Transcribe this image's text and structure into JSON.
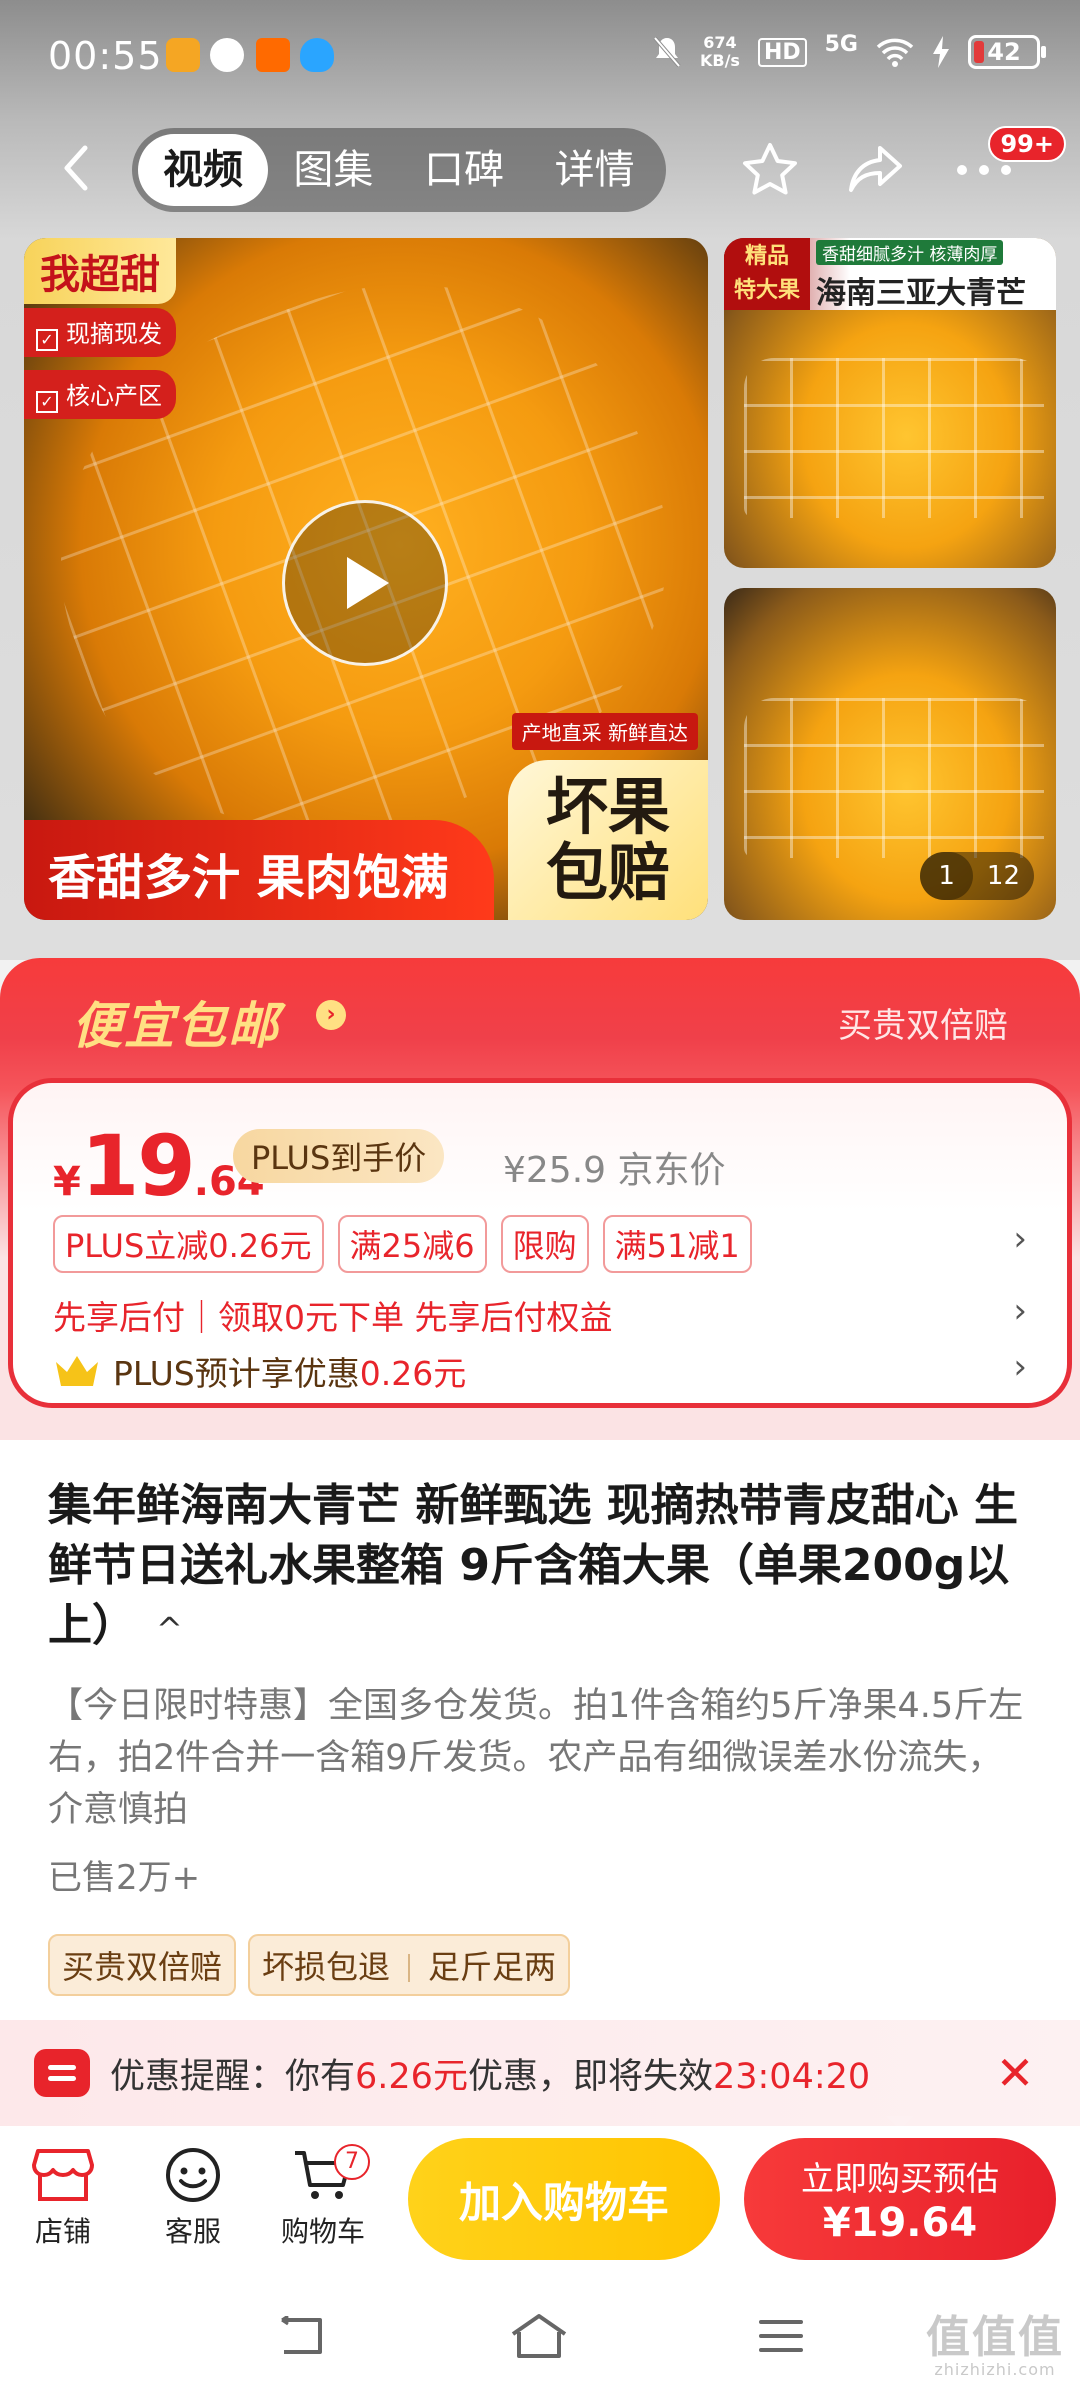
{
  "status_bar": {
    "time": "00:55",
    "net_speed_value": "674",
    "net_speed_unit": "KB/s",
    "hd": "HD",
    "network": "5G",
    "battery": "42",
    "colors": {
      "app1": "#f5a623",
      "app2": "#ffffff",
      "app3": "#ff6a00",
      "app4": "#2aa5ff"
    }
  },
  "nav": {
    "tabs": [
      "视频",
      "图集",
      "口碑",
      "详情"
    ],
    "active_tab": "视频",
    "badge": "99+"
  },
  "gallery": {
    "main_top_tag": "我超甜",
    "main_chips": [
      "现摘现发",
      "核心产区"
    ],
    "main_origin_tag": "产地直采 新鲜直达",
    "main_banner": "香甜多汁 果肉饱满",
    "main_corner_line1": "坏果",
    "main_corner_line2": "包赔",
    "side1_tag_line1": "精品",
    "side1_tag_line2": "特大果",
    "side1_sub": "香甜细腻多汁 核薄肉厚",
    "side1_title": "海南三亚大青芒",
    "counter_current": "1",
    "counter_total": "12"
  },
  "promo": {
    "title": "便宜包邮",
    "guarantee": "买贵双倍赔",
    "price_symbol": "¥",
    "price_int": "19",
    "price_dec": ".64",
    "plus_label": "PLUS到手价",
    "jd_price": "¥25.9 京东价",
    "coupons": [
      "PLUS立减0.26元",
      "满25减6",
      "限购",
      "满51减1"
    ],
    "paylater": "先享后付｜领取0元下单 先享后付权益",
    "plus_estimate_prefix": "PLUS预计享优惠",
    "plus_estimate_value": "0.26元"
  },
  "product": {
    "title": "集年鲜海南大青芒 新鲜甄选 现摘热带青皮甜心 生鲜节日送礼水果整箱 9斤含箱大果（单果200g以上）",
    "description": "【今日限时特惠】全国多仓发货。拍1件含箱约5斤净果4.5斤左右，拍2件合并一含箱9斤发货。农产品有细微误差水份流失，介意慎拍",
    "sold": "已售2万+",
    "service_tags": [
      "买贵双倍赔",
      "坏损包退",
      "足斤足两"
    ]
  },
  "reminder": {
    "prefix": "优惠提醒：你有",
    "amount": "6.26元",
    "middle": "优惠，即将失效",
    "countdown": "23:04:20"
  },
  "actions": {
    "shop": "店铺",
    "service": "客服",
    "cart": "购物车",
    "cart_count": "7",
    "add_to_cart": "加入购物车",
    "buy_line1": "立即购买预估",
    "buy_line2": "¥19.64"
  },
  "watermark": {
    "text": "值值值",
    "url": "zhizhizhi.com"
  }
}
